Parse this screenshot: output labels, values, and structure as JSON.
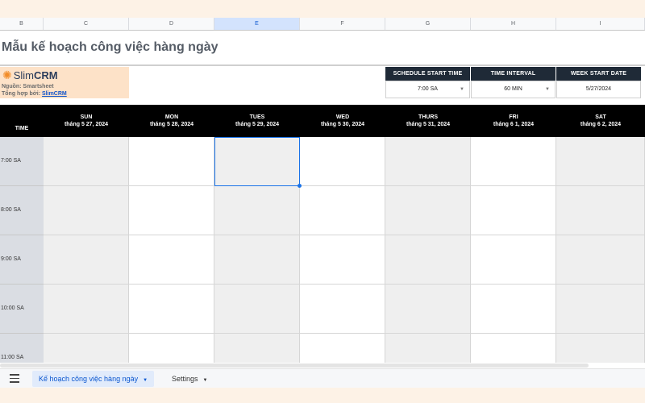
{
  "columns": [
    "B",
    "C",
    "D",
    "E",
    "F",
    "G",
    "H",
    "I"
  ],
  "title": "Mẫu kế hoạch công việc hàng ngày",
  "logo": {
    "brand_light": "Slim",
    "brand_bold": "CRM",
    "icon": "sun-icon"
  },
  "source": "Nguồn: Smartsheet",
  "aggregated_by_label": "Tổng hợp bởi:",
  "aggregated_by_link": "SlimCRM",
  "settings": {
    "start_time": {
      "label": "SCHEDULE START TIME",
      "value": "7:00 SA"
    },
    "interval": {
      "label": "TIME INTERVAL",
      "value": "60 MIN"
    },
    "week_start": {
      "label": "WEEK START DATE",
      "value": "5/27/2024"
    }
  },
  "time_header": "TIME",
  "days": [
    {
      "name": "SUN",
      "date": "tháng 5 27, 2024"
    },
    {
      "name": "MON",
      "date": "tháng 5 28, 2024"
    },
    {
      "name": "TUES",
      "date": "tháng 5 29, 2024"
    },
    {
      "name": "WED",
      "date": "tháng 5 30, 2024"
    },
    {
      "name": "THURS",
      "date": "tháng 5 31, 2024"
    },
    {
      "name": "FRI",
      "date": "tháng 6 1, 2024"
    },
    {
      "name": "SAT",
      "date": "tháng 6 2, 2024"
    }
  ],
  "times": [
    "7:00 SA",
    "8:00 SA",
    "9:00 SA",
    "10:00 SA",
    "11:00 SA"
  ],
  "tabs": [
    {
      "label": "Kế hoạch công việc hàng ngày",
      "active": true
    },
    {
      "label": "Settings",
      "active": false
    }
  ],
  "colors": {
    "header_black": "#000000",
    "setting_header": "#1f2a37",
    "logo_bg": "#fde2c8",
    "accent": "#1a73e8"
  }
}
